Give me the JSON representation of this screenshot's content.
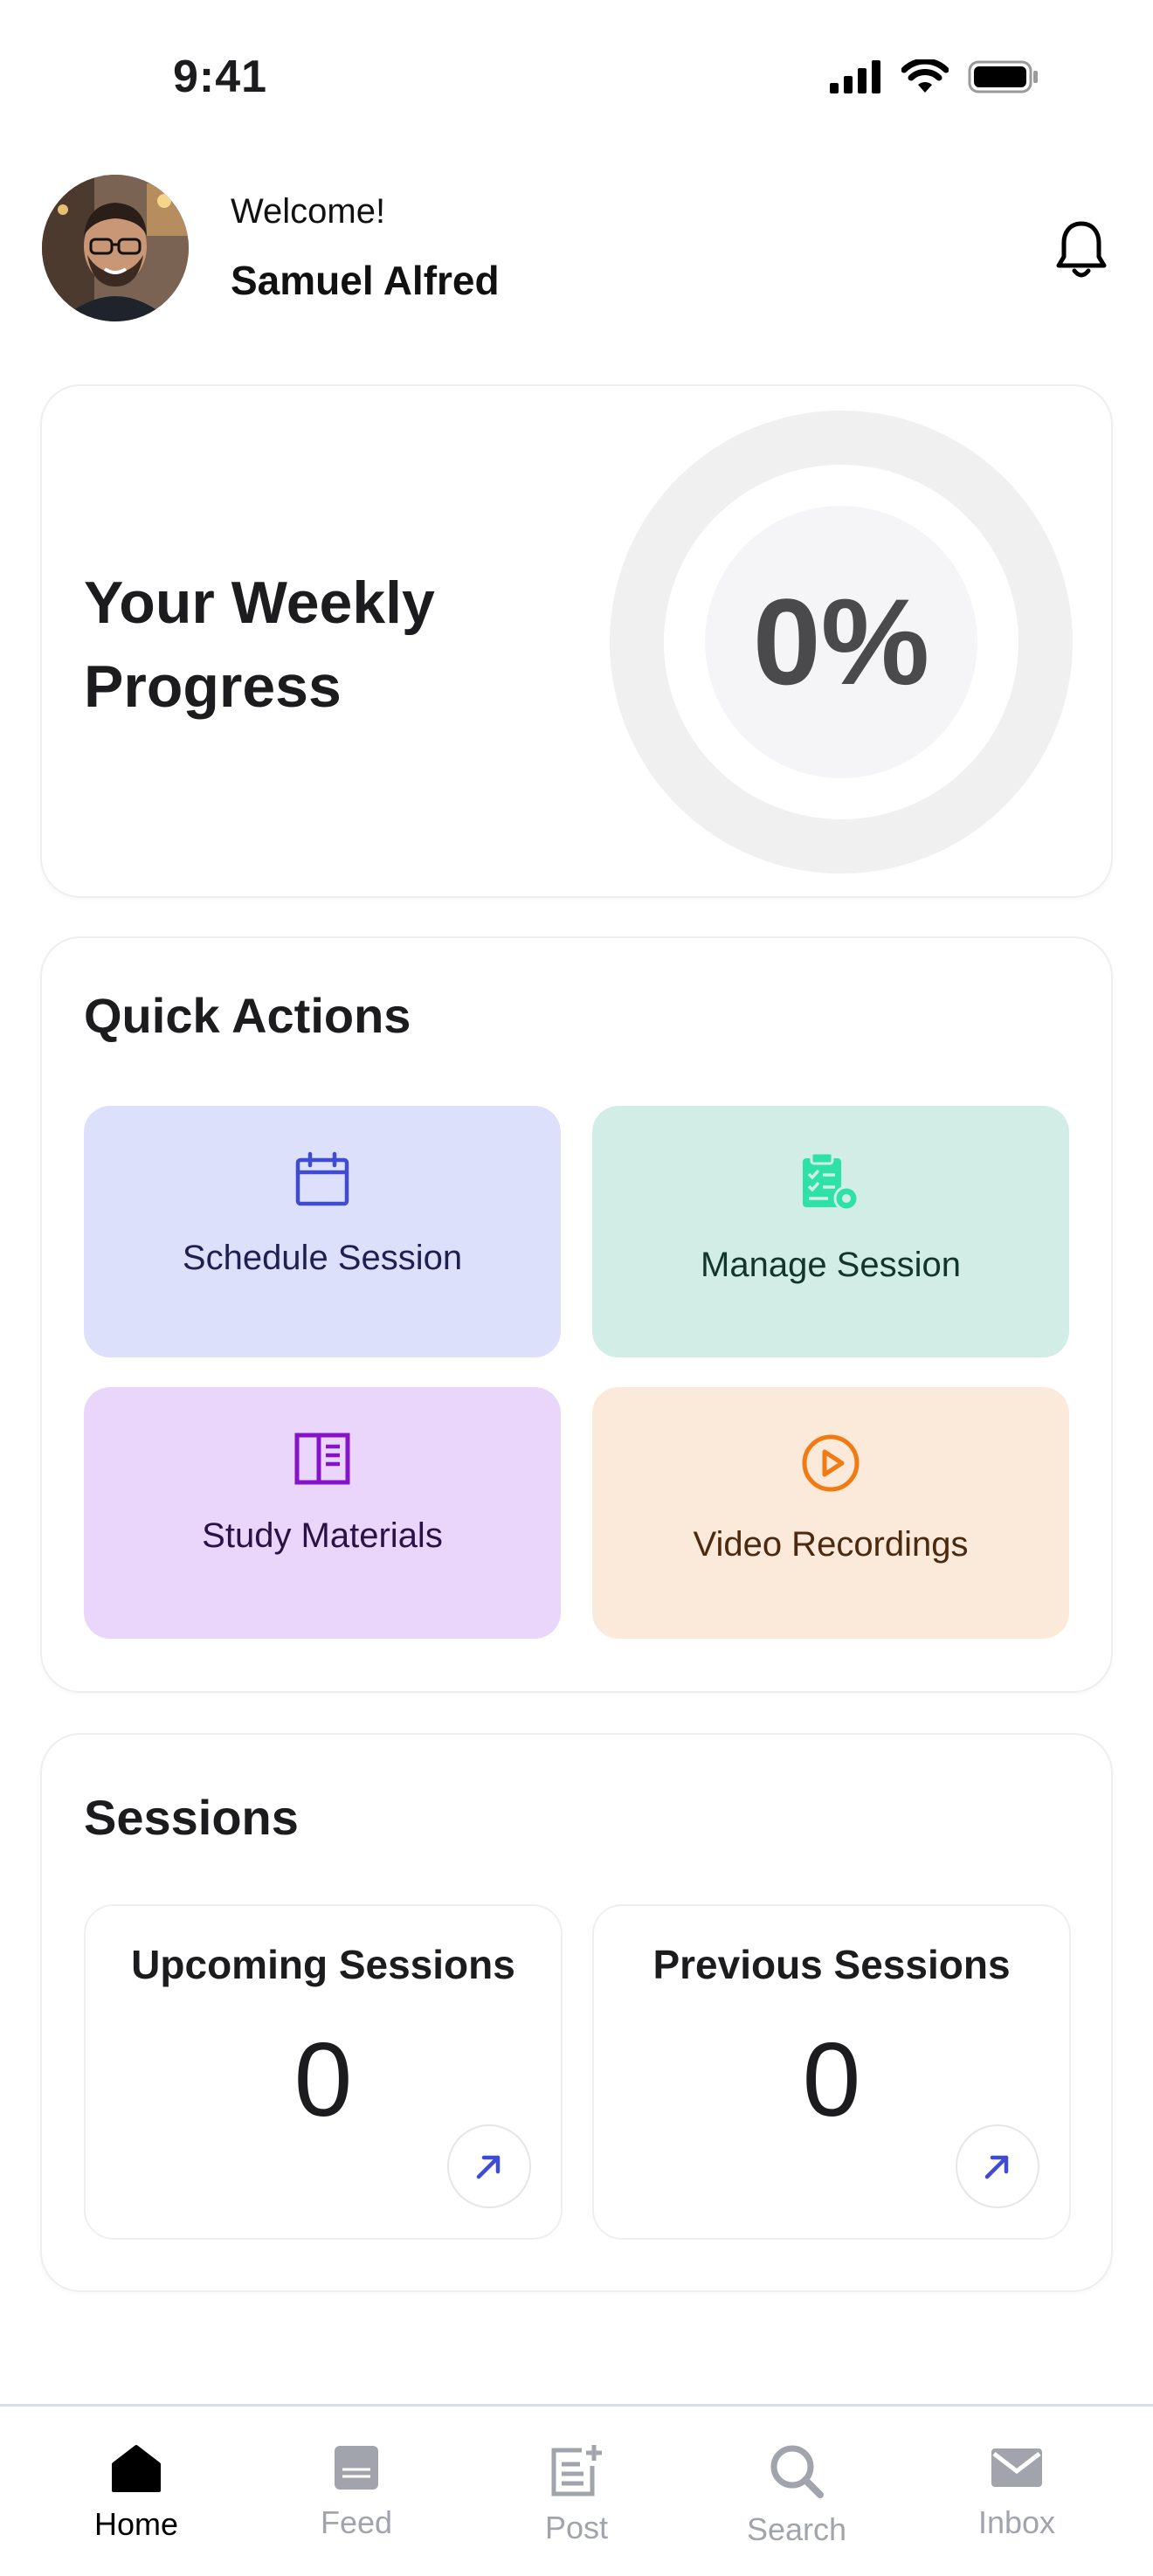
{
  "status_bar": {
    "time": "9:41"
  },
  "header": {
    "welcome": "Welcome!",
    "user_name": "Samuel Alfred"
  },
  "progress": {
    "title": "Your Weekly Progress",
    "value_text": "0%",
    "value": 0
  },
  "quick_actions": {
    "title": "Quick Actions",
    "items": [
      {
        "label": "Schedule Session",
        "icon": "calendar-icon",
        "bg": "#dde0fb",
        "fg": "#3f4bd0",
        "text": "#1f2050"
      },
      {
        "label": "Manage Session",
        "icon": "clipboard-settings-icon",
        "bg": "#d1ede6",
        "fg": "#2ee1a6",
        "text": "#14352c"
      },
      {
        "label": "Study Materials",
        "icon": "book-panel-icon",
        "bg": "#ead6fb",
        "fg": "#8413c9",
        "text": "#2b1244"
      },
      {
        "label": "Video Recordings",
        "icon": "play-circle-icon",
        "bg": "#fbe9da",
        "fg": "#f27a12",
        "text": "#4a2a10"
      }
    ]
  },
  "sessions": {
    "title": "Sessions",
    "upcoming": {
      "label": "Upcoming Sessions",
      "count": "0"
    },
    "previous": {
      "label": "Previous Sessions",
      "count": "0"
    },
    "arrow_color": "#3f4bd0"
  },
  "tab_bar": {
    "items": [
      {
        "label": "Home",
        "icon": "home-icon",
        "active": true
      },
      {
        "label": "Feed",
        "icon": "feed-icon",
        "active": false
      },
      {
        "label": "Post",
        "icon": "post-icon",
        "active": false
      },
      {
        "label": "Search",
        "icon": "search-icon",
        "active": false
      },
      {
        "label": "Inbox",
        "icon": "inbox-icon",
        "active": false
      }
    ]
  }
}
